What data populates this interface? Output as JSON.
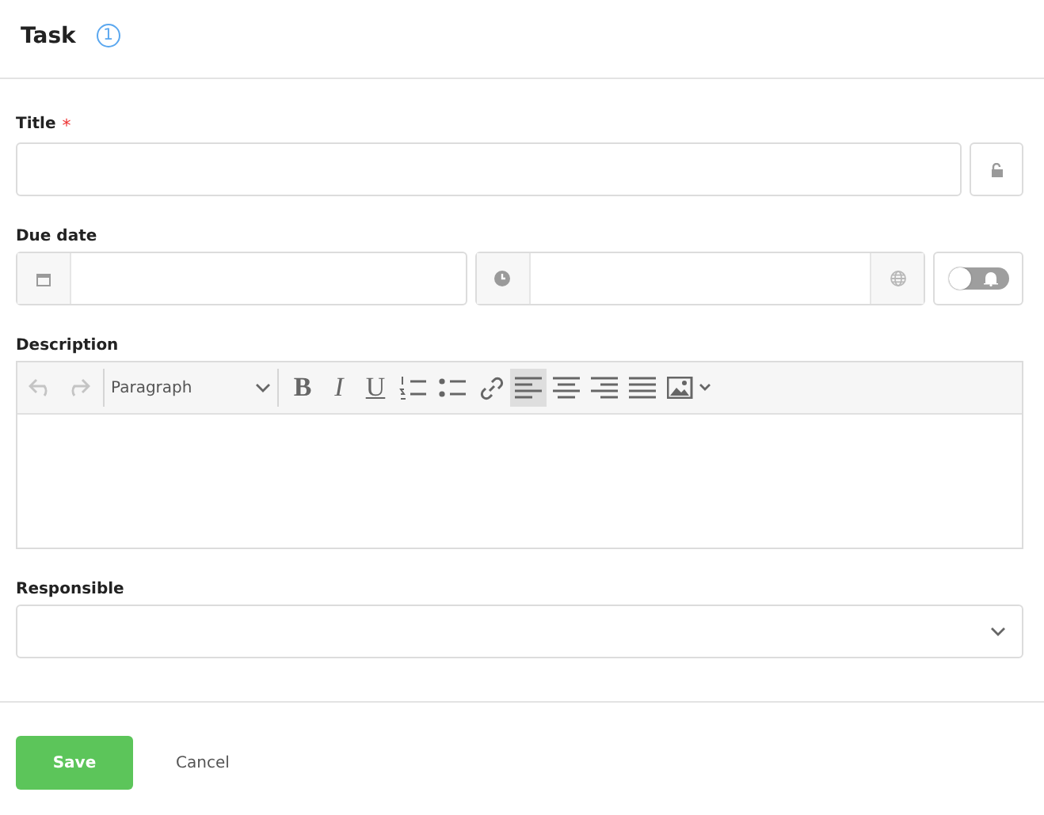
{
  "header": {
    "title": "Task",
    "badge": "1"
  },
  "title_field": {
    "label": "Title",
    "required_mark": "*",
    "locked": false
  },
  "due_date": {
    "label": "Due date",
    "reminder_on": false
  },
  "description": {
    "label": "Description",
    "block_format": "Paragraph",
    "tools": [
      {
        "kind": "undo",
        "disabled": true,
        "selected": false
      },
      {
        "kind": "redo",
        "disabled": true,
        "selected": false
      },
      {
        "kind": "bold",
        "label": "B",
        "disabled": false,
        "selected": false
      },
      {
        "kind": "italic",
        "label": "I",
        "disabled": false,
        "selected": false
      },
      {
        "kind": "underline",
        "label": "U",
        "disabled": false,
        "selected": false
      },
      {
        "kind": "ordered-list",
        "disabled": false,
        "selected": false
      },
      {
        "kind": "bullet-list",
        "disabled": false,
        "selected": false
      },
      {
        "kind": "link",
        "disabled": false,
        "selected": false
      },
      {
        "kind": "align-left",
        "disabled": false,
        "selected": true
      },
      {
        "kind": "align-center",
        "disabled": false,
        "selected": false
      },
      {
        "kind": "align-right",
        "disabled": false,
        "selected": false
      },
      {
        "kind": "justify",
        "disabled": false,
        "selected": false
      },
      {
        "kind": "image",
        "disabled": false,
        "selected": false
      }
    ]
  },
  "responsible": {
    "label": "Responsible"
  },
  "buttons": [
    {
      "kind": "primary",
      "label": "Save"
    },
    {
      "kind": "link",
      "label": "Cancel"
    }
  ]
}
